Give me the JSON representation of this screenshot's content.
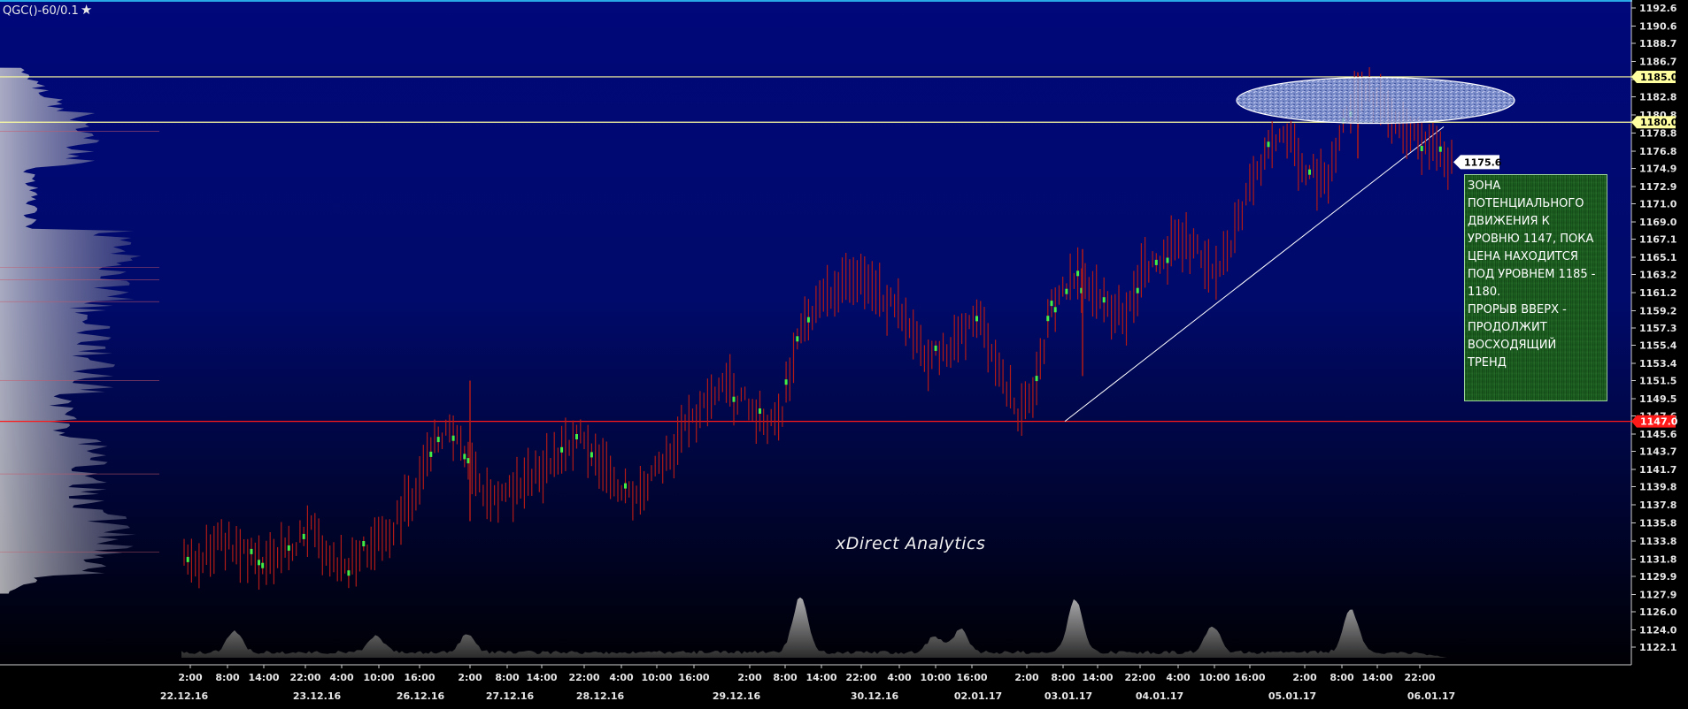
{
  "header": {
    "symbol": "QGC()-60/0.1",
    "star_icon": "★"
  },
  "watermark": "xDirect Analytics",
  "annotation": {
    "lines": [
      "ЗОНА",
      "ПОТЕНЦИАЛЬНОГО",
      "ДВИЖЕНИЯ К",
      "УРОВНЮ 1147, ПОКА",
      "ЦЕНА НАХОДИТСЯ",
      "ПОД УРОВНЕМ 1185 -",
      "1180.",
      "ПРОРЫВ ВВЕРХ -",
      "ПРОДОЛЖИТ",
      "ВОСХОДЯЩИЙ",
      "ТРЕНД"
    ]
  },
  "colors": {
    "background_top": "#00087a",
    "background_bottom": "#000004",
    "bar": "#b11a16",
    "bar_highlight": "#44ee44",
    "level_yellow": "#ffffa0",
    "level_red": "#ff1a1a",
    "price_tag": "#ffffff",
    "top_border": "#29a9e6"
  },
  "chart_data": {
    "type": "line",
    "title": "",
    "ylim": [
      1120.8,
      1193.4
    ],
    "y_ticks": [
      "1192.6",
      "1190.6",
      "1188.7",
      "1186.7",
      "1184.7",
      "1182.8",
      "1180.8",
      "1178.8",
      "1176.8",
      "1174.9",
      "1172.9",
      "1171.0",
      "1169.0",
      "1167.1",
      "1165.1",
      "1163.2",
      "1161.2",
      "1159.2",
      "1157.3",
      "1155.4",
      "1153.4",
      "1151.5",
      "1149.5",
      "1147.6",
      "1145.6",
      "1143.7",
      "1141.7",
      "1139.8",
      "1137.8",
      "1135.8",
      "1133.8",
      "1131.8",
      "1129.9",
      "1127.9",
      "1126.0",
      "1124.0",
      "1122.1"
    ],
    "x_time_labels": [
      "2:00",
      "8:00",
      "14:00",
      "22:00",
      "4:00",
      "10:00",
      "16:00",
      "2:00",
      "8:00",
      "14:00",
      "22:00",
      "4:00",
      "10:00",
      "16:00",
      "2:00",
      "8:00",
      "14:00",
      "22:00",
      "4:00",
      "10:00",
      "16:00",
      "2:00",
      "8:00",
      "14:00",
      "22:00",
      "4:00",
      "10:00",
      "16:00",
      "2:00",
      "8:00",
      "14:00",
      "22:00"
    ],
    "x_date_labels": [
      "22.12.16",
      "23.12.16",
      "26.12.16",
      "27.12.16",
      "28.12.16",
      "29.12.16",
      "30.12.16",
      "02.01.17",
      "03.01.17",
      "04.01.17",
      "05.01.17",
      "06.01.17"
    ],
    "price_series_approx": [
      1133,
      1132,
      1134,
      1133,
      1131,
      1132,
      1133,
      1135,
      1132,
      1131,
      1133,
      1134,
      1137,
      1140,
      1146,
      1145,
      1141,
      1138,
      1139,
      1141,
      1142,
      1144,
      1145,
      1142,
      1140,
      1139,
      1141,
      1144,
      1147,
      1150,
      1151,
      1149,
      1147,
      1148,
      1158,
      1160,
      1162,
      1163,
      1161,
      1160,
      1158,
      1153,
      1155,
      1157,
      1158,
      1153,
      1148,
      1151,
      1160,
      1163,
      1162,
      1160,
      1158,
      1164,
      1165,
      1167,
      1166,
      1163,
      1168,
      1174,
      1177,
      1178,
      1175,
      1173,
      1179,
      1184,
      1182,
      1180,
      1178,
      1177,
      1175.6
    ],
    "levels": [
      {
        "label": "1185.0",
        "value": 1185.0,
        "color": "#ffffa0"
      },
      {
        "label": "1180.0",
        "value": 1180.0,
        "color": "#ffffa0"
      },
      {
        "label": "1147.0",
        "value": 1147.0,
        "color": "#ff1a1a"
      }
    ],
    "last_price": {
      "label": "1175.6",
      "value": 1175.6
    },
    "trendline": {
      "from": {
        "x": "03.01.17 2:00",
        "y": 1147.0
      },
      "to": {
        "x": "06.01.17 ~2:00",
        "y": 1179.5
      }
    },
    "highlight_zone": {
      "y_range": [
        1180.0,
        1185.0
      ],
      "shape": "ellipse"
    },
    "volume_profile": "left-side horizontal histogram",
    "volume_histogram": "bottom area, peaks near 29.12.16 and 03.01.17 and 05.01.17",
    "grid": false
  }
}
